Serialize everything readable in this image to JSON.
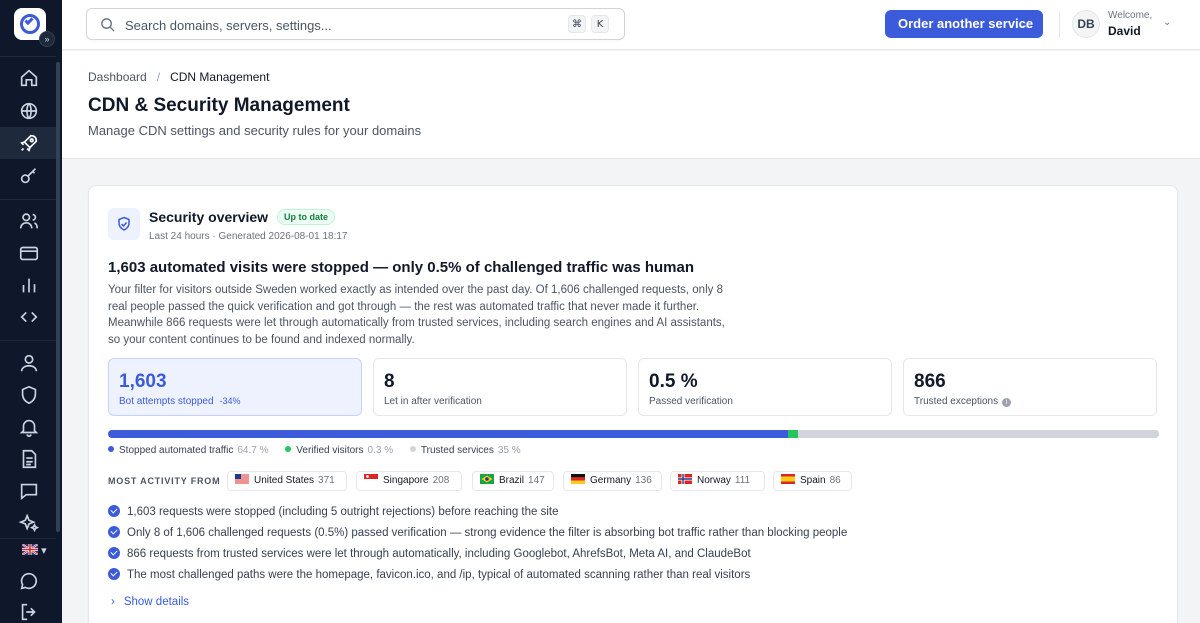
{
  "sidebar": {
    "expand_glyph": "»",
    "language": "▾",
    "icons": [
      "home-icon",
      "globe-icon",
      "rocket-icon",
      "key-icon",
      "users-icon",
      "credit-card-icon",
      "bar-chart-icon",
      "code-icon",
      "user-icon",
      "shield-icon",
      "bell-icon",
      "document-icon",
      "message-icon",
      "sparkle-icon",
      "chat-icon",
      "logout-icon"
    ],
    "active": "rocket-icon"
  },
  "header": {
    "search_placeholder": "Search domains, servers, settings...",
    "shortcut_keys": [
      "⌘",
      "K"
    ],
    "order_button": "Order another service",
    "order_arrow": "→",
    "avatar_initials": "DB",
    "welcome": "Welcome,",
    "user_name": "David"
  },
  "page": {
    "breadcrumb": [
      "Dashboard",
      "CDN Management"
    ],
    "title": "CDN & Security Management",
    "subtitle": "Manage CDN settings and security rules for your domains"
  },
  "overview": {
    "title": "Security overview",
    "status_badge": "Up to date",
    "meta": "Last 24 hours · Generated 2026-08-01 18:17",
    "headline": "1,603 automated visits were stopped — only 0.5% of challenged traffic was human",
    "summary": "Your filter for visitors outside Sweden worked exactly as intended over the past day. Of 1,606 challenged requests, only 8 real people passed the quick verification and got through — the rest was automated traffic that never made it further. Meanwhile 866 requests were let through automatically from trusted services, including search engines and AI assistants, so your content continues to be found and indexed normally.",
    "stats": [
      {
        "value": "1,603",
        "label": "Bot attempts stopped",
        "delta": "-34%"
      },
      {
        "value": "8",
        "label": "Let in after verification"
      },
      {
        "value": "0.5 %",
        "label": "Passed verification"
      },
      {
        "value": "866",
        "label": "Trusted exceptions",
        "info": "i"
      }
    ],
    "traffic_split": [
      {
        "label": "Stopped automated traffic",
        "pct_label": "64.7 %",
        "pct": 64.7,
        "color": "#3b5bdb"
      },
      {
        "label": "Verified visitors",
        "pct_label": "0.3 %",
        "pct": 0.3,
        "color": "#22c55e"
      },
      {
        "label": "Trusted services",
        "pct_label": "35 %",
        "pct": 35,
        "color": "#d1d5db"
      }
    ],
    "activity_label": "MOST ACTIVITY FROM",
    "countries": [
      {
        "name": "United States",
        "count": "371"
      },
      {
        "name": "Singapore",
        "count": "208"
      },
      {
        "name": "Brazil",
        "count": "147"
      },
      {
        "name": "Germany",
        "count": "136"
      },
      {
        "name": "Norway",
        "count": "111"
      },
      {
        "name": "Spain",
        "count": "86"
      }
    ],
    "bullets": [
      "1,603 requests were stopped (including 5 outright rejections) before reaching the site",
      "Only 8 of 1,606 challenged requests (0.5%) passed verification — strong evidence the filter is absorbing bot traffic rather than blocking people",
      "866 requests from trusted services were let through automatically, including Googlebot, AhrefsBot, Meta AI, and ClaudeBot",
      "The most challenged paths were the homepage, favicon.ico, and /ip, typical of automated scanning rather than real visitors"
    ],
    "show_details": "Show details",
    "show_details_chevron": "›"
  },
  "colors": {
    "accent": "#3b5bdb",
    "sidebar_bg": "#0f172a",
    "success": "#22c55e"
  }
}
